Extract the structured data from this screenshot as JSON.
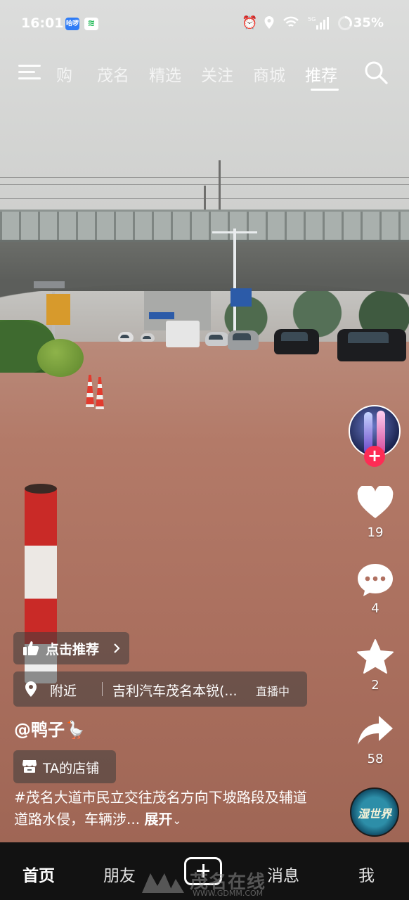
{
  "status_bar": {
    "time": "16:01",
    "app_badge_1": "哈啰",
    "battery": "35%"
  },
  "top_nav": {
    "tabs": [
      "购",
      "茂名",
      "精选",
      "关注",
      "商城",
      "推荐"
    ],
    "active_tab": "推荐"
  },
  "right_rail": {
    "likes": "19",
    "comments": "4",
    "favorites": "2",
    "shares": "58",
    "music_disc_text": "湿世界"
  },
  "overlay": {
    "recommend_label": "点击推荐",
    "location_near": "附近",
    "location_place": "吉利汽车茂名本锐(...",
    "location_live": "直播中",
    "author": "@鸭子🪿",
    "shop_label": "TA的店铺",
    "description": "#茂名大道市民立交往茂名方向下坡路段及辅道道路水侵，车辆涉...",
    "expand_label": "展开"
  },
  "bottom_nav": {
    "items": [
      "首页",
      "朋友",
      "消息",
      "我"
    ],
    "active": "首页"
  },
  "watermark": {
    "text": "茂名在线",
    "url": "WWW.GDMM.COM"
  },
  "colors": {
    "follow_plus": "#fe2c55",
    "bottom_nav_bg": "#121212"
  }
}
